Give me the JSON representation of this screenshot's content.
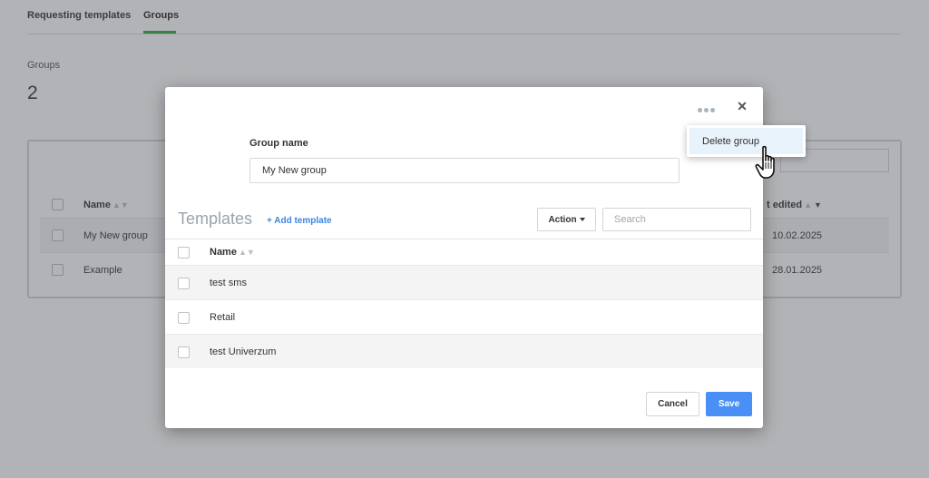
{
  "background": {
    "tabs": [
      {
        "label": "Requesting templates"
      },
      {
        "label": "Groups"
      }
    ],
    "groups_label": "Groups",
    "groups_count": "2",
    "table": {
      "col_name": "Name",
      "col_edited": "t edited",
      "rows": [
        {
          "name": "My New group",
          "date": "10.02.2025"
        },
        {
          "name": "Example",
          "date": "28.01.2025"
        }
      ]
    }
  },
  "modal": {
    "group_name_label": "Group name",
    "group_name_value": "My New group",
    "templates_title": "Templates",
    "add_template": "+ Add template",
    "action_label": "Action",
    "search_placeholder": "Search",
    "column_name": "Name",
    "rows": [
      {
        "name": "test sms"
      },
      {
        "name": "Retail"
      },
      {
        "name": "test Univerzum"
      }
    ],
    "cancel_label": "Cancel",
    "save_label": "Save",
    "close_glyph": "✕"
  },
  "dropdown": {
    "items": [
      {
        "label": "Delete group"
      }
    ]
  },
  "icons": {
    "more": "ellipsis-icon",
    "close": "close-icon",
    "sort": "sort-icon",
    "cursor": "hand-pointer-icon"
  },
  "colors": {
    "active_tab": "#2eaa3f",
    "primary": "#4a8ff5",
    "link": "#3b86e0",
    "dropdown_highlight": "#e8f2fb"
  }
}
